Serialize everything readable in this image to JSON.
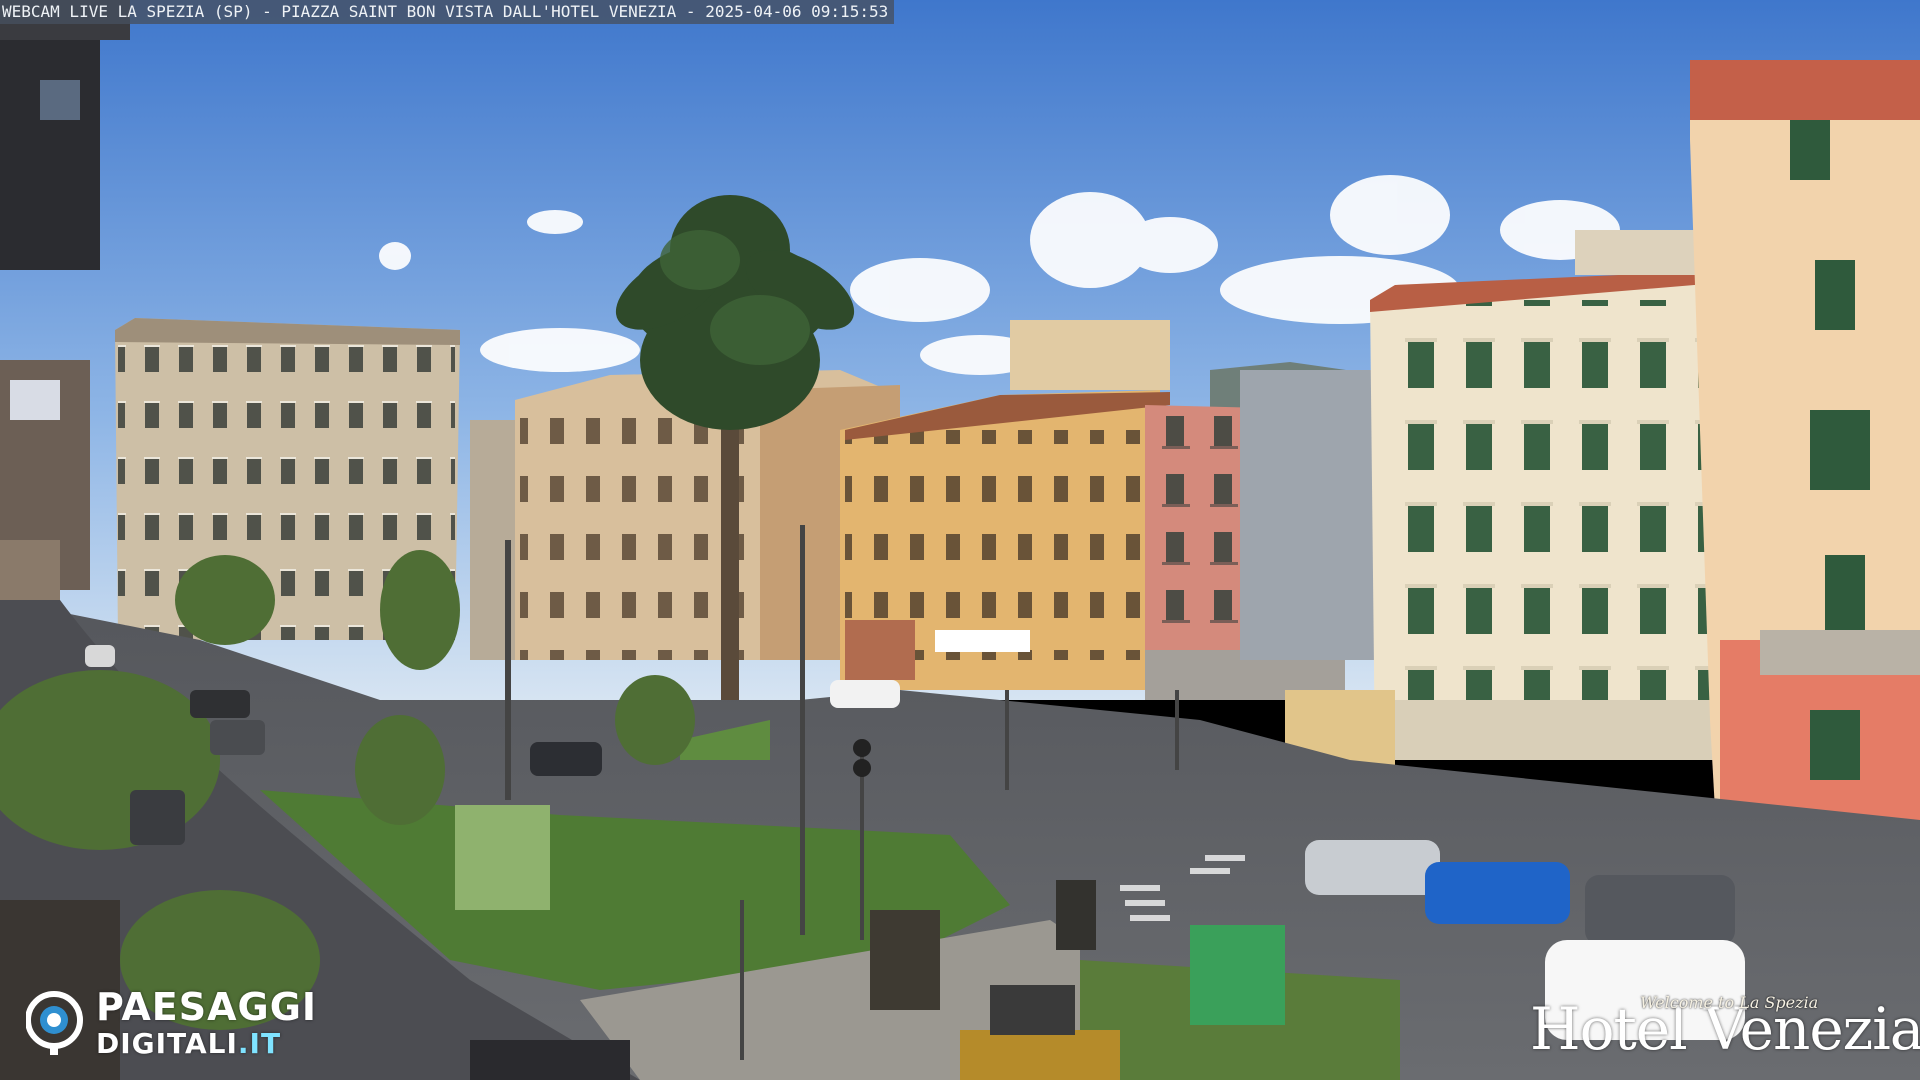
{
  "overlay": {
    "caption": "WEBCAM LIVE LA SPEZIA (SP) - PIAZZA SAINT BON VISTA DALL'HOTEL VENEZIA - 2025-04-06 09:15:53"
  },
  "watermark_left": {
    "line1": "PAESAGGI",
    "line2_main": "DIGITALI",
    "line2_suffix": ".IT",
    "icon": "camera-lens-icon"
  },
  "watermark_right": {
    "welcome": "Welcome to La Spezia",
    "hotel": "Hotel Venezia"
  },
  "colors": {
    "sky_top": "#4a7fd0",
    "sky_bottom": "#cfe1f3",
    "road": "#5c5e63",
    "grass": "#4f7b34",
    "ochre_building": "#e3b56f",
    "pink_building": "#d48a7c",
    "cream_building": "#efe4cc",
    "red_building": "#e57c66"
  }
}
